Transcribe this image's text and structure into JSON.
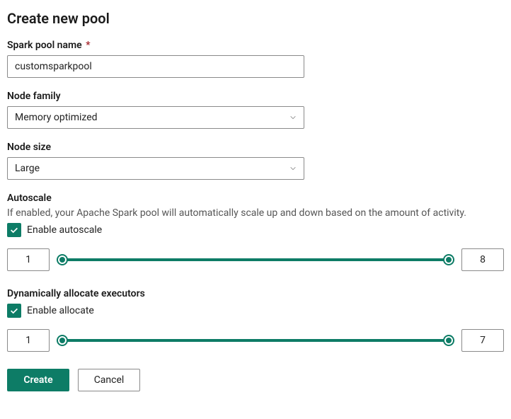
{
  "page_title": "Create new pool",
  "spark_pool_name": {
    "label": "Spark pool name",
    "required_marker": "*",
    "value": "customsparkpool"
  },
  "node_family": {
    "label": "Node family",
    "selected": "Memory optimized"
  },
  "node_size": {
    "label": "Node size",
    "selected": "Large"
  },
  "autoscale": {
    "label": "Autoscale",
    "help": "If enabled, your Apache Spark pool will automatically scale up and down based on the amount of activity.",
    "checkbox_label": "Enable autoscale",
    "checked": true,
    "min_value": "1",
    "max_value": "8"
  },
  "dynamic_executors": {
    "label": "Dynamically allocate executors",
    "checkbox_label": "Enable allocate",
    "checked": true,
    "min_value": "1",
    "max_value": "7"
  },
  "buttons": {
    "create": "Create",
    "cancel": "Cancel"
  }
}
